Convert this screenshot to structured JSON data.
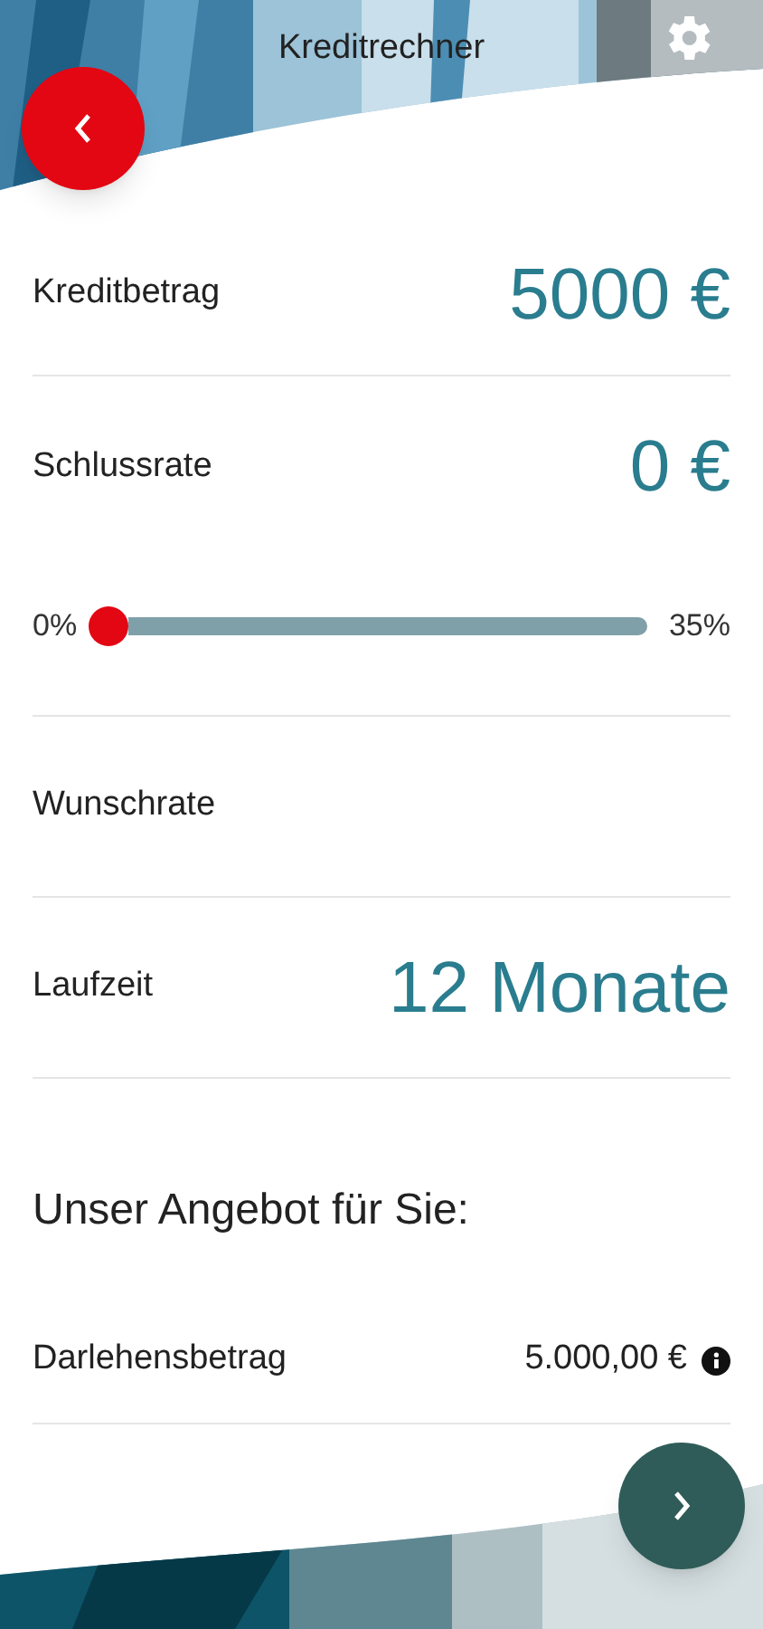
{
  "header": {
    "title": "Kreditrechner"
  },
  "rows": [
    {
      "kind": "value",
      "label": "Kreditbetrag",
      "value": "5000 €"
    },
    {
      "kind": "value",
      "label": "Schlussrate",
      "value": "0 €"
    },
    {
      "kind": "slider",
      "min_label": "0%",
      "max_label": "35%",
      "level": 0
    },
    {
      "kind": "value",
      "label": "Wunschrate"
    },
    {
      "kind": "value",
      "label": "Laufzeit",
      "value": "12 Monate"
    }
  ],
  "offer": {
    "heading": "Unser Angebot für Sie:",
    "items": [
      {
        "label": "Darlehensbetrag",
        "value": "5.000,00 €",
        "info": true
      }
    ]
  }
}
